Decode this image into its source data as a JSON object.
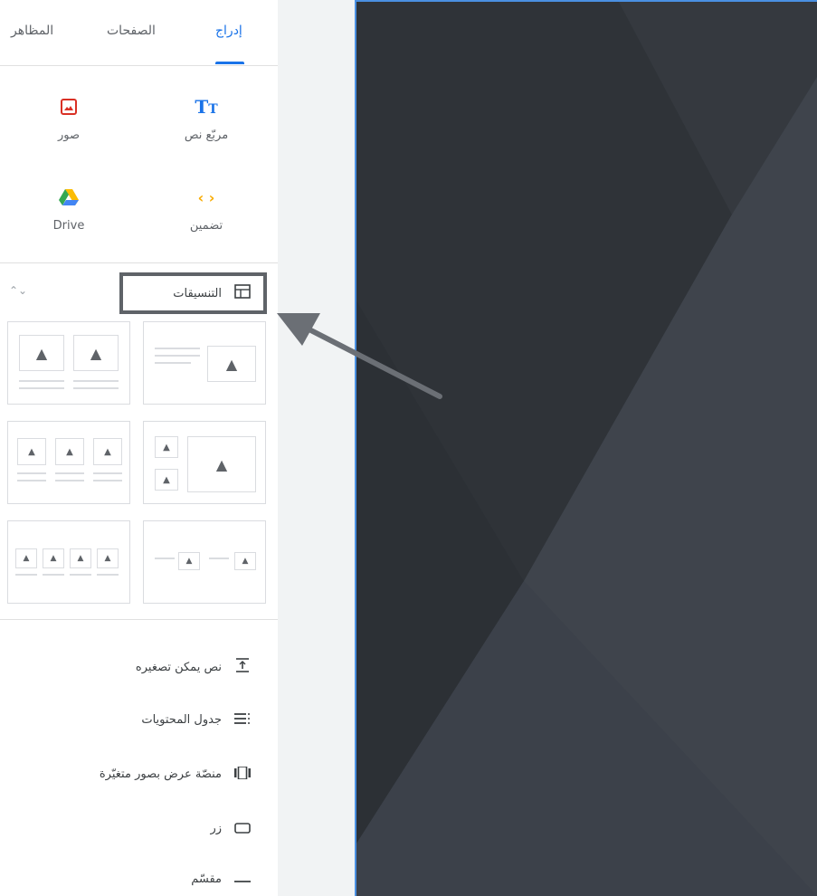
{
  "tabs": [
    {
      "label": "إدراج",
      "active": true
    },
    {
      "label": "الصفحات",
      "active": false
    },
    {
      "label": "المظاهر",
      "active": false
    }
  ],
  "insert": {
    "text_box": {
      "label": "مربّع نص",
      "icon": "text-box-icon"
    },
    "images": {
      "label": "صور",
      "icon": "image-icon"
    },
    "embed": {
      "label": "تضمين",
      "icon": "embed-icon"
    },
    "drive": {
      "label": "Drive",
      "icon": "google-drive-icon"
    }
  },
  "layouts": {
    "label": "التنسيقات",
    "icon": "layouts-icon",
    "collapse_icon": "collapse-icon"
  },
  "components": [
    {
      "label": "نص يمكن تصغيره",
      "icon": "collapsible-text-icon"
    },
    {
      "label": "جدول المحتويات",
      "icon": "table-of-contents-icon"
    },
    {
      "label": "منصّة عرض بصور متغيّرة",
      "icon": "carousel-icon"
    },
    {
      "label": "زر",
      "icon": "button-icon"
    },
    {
      "label": "مقسّم",
      "icon": "divider-icon"
    }
  ],
  "colors": {
    "accent": "#1a73e8",
    "canvas": "#3a3f47",
    "annotation": "#5f6368"
  }
}
